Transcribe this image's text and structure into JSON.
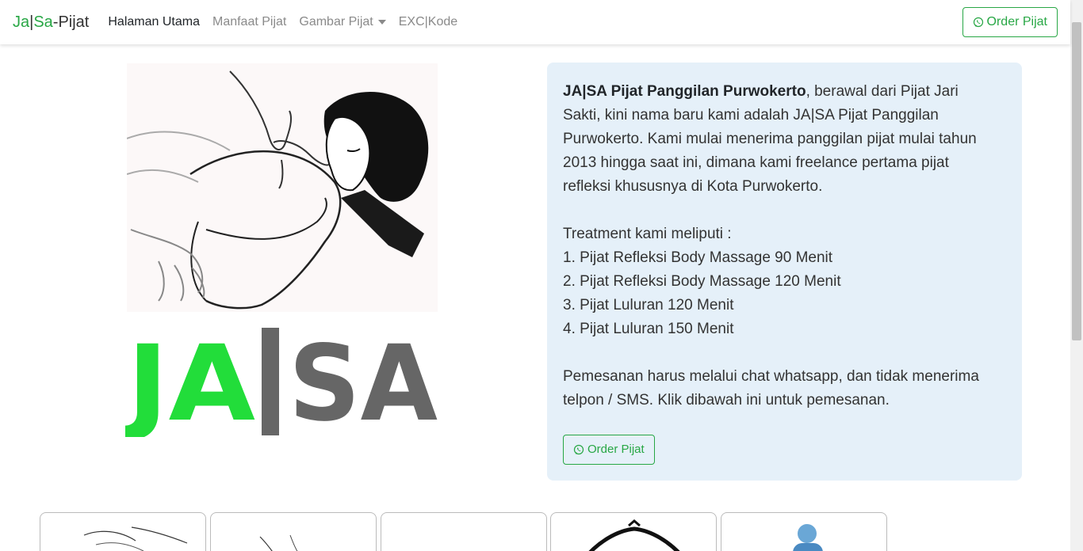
{
  "navbar": {
    "brand_ja": "Ja",
    "brand_sep": "|",
    "brand_sa": "Sa",
    "brand_rest": "-Pijat",
    "links": [
      {
        "label": "Halaman Utama"
      },
      {
        "label": "Manfaat Pijat"
      },
      {
        "label": "Gambar Pijat"
      },
      {
        "label": "EXC|Kode"
      }
    ],
    "order_label": "Order Pijat"
  },
  "logo": {
    "ja": "JA",
    "sa": "SA"
  },
  "info": {
    "bold_title": "JA|SA Pijat Panggilan Purwokerto",
    "intro_lines": [
      ", berawal dari Pijat Jari",
      "Sakti, kini nama baru kami adalah JA|SA Pijat Panggilan",
      "Purwokerto. Kami mulai menerima panggilan pijat mulai tahun",
      "2013 hingga saat ini, dimana kami freelance pertama pijat",
      "refleksi khususnya di Kota Purwokerto."
    ],
    "treatment_heading": "Treatment kami meliputi :",
    "treatments": [
      "1. Pijat Refleksi Body Massage 90 Menit",
      "2. Pijat Refleksi Body Massage 120 Menit",
      "3. Pijat Luluran 120 Menit",
      "4. Pijat Luluran 150 Menit"
    ],
    "note_lines": [
      "Pemesanan harus melalui chat whatsapp, dan tidak menerima",
      "telpon / SMS. Klik dibawah ini untuk pemesanan."
    ],
    "order_label": "Order Pijat"
  },
  "colors": {
    "brand_green": "#28a745",
    "logo_green": "#22dd3a",
    "logo_gray": "#666666",
    "info_bg": "#e5f0f9"
  }
}
